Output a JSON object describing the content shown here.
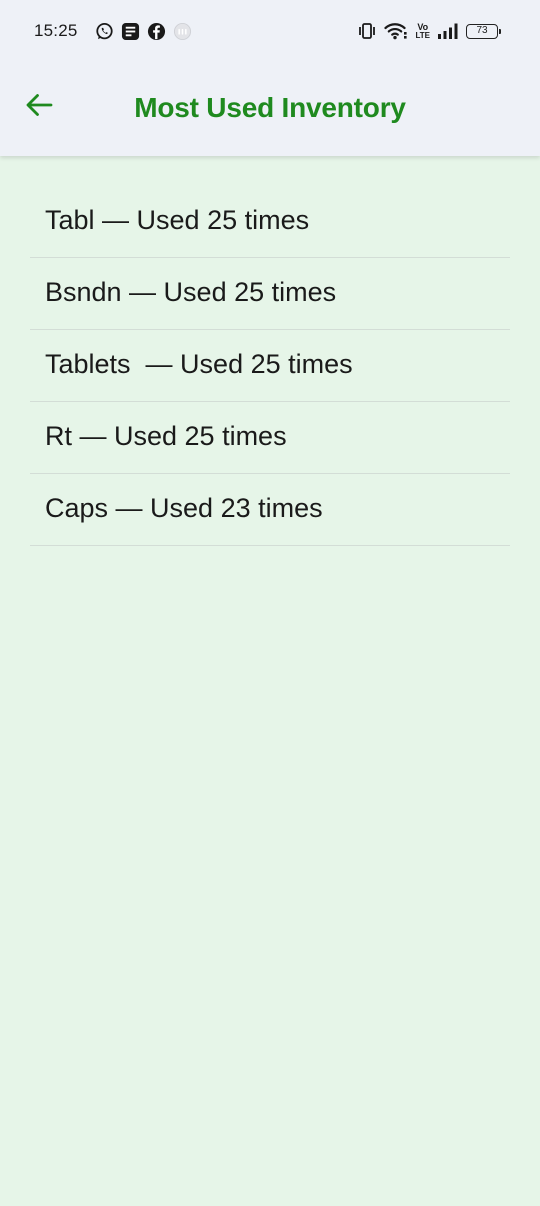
{
  "status_bar": {
    "time": "15:25",
    "notification_icons": [
      "whatsapp-icon",
      "notes-app-icon",
      "facebook-icon",
      "app-badge-icon"
    ],
    "system_icons": [
      "vibrate-icon",
      "wifi-icon",
      "volte-icon",
      "signal-icon"
    ],
    "volte_top": "Vo",
    "volte_bottom": "LTE",
    "battery_level": "73"
  },
  "header": {
    "back_icon": "arrow-left-icon",
    "title": "Most Used Inventory"
  },
  "items": [
    {
      "text": "Tabl — Used 25 times"
    },
    {
      "text": "Bsndn — Used 25 times"
    },
    {
      "text": "Tablets  — Used 25 times"
    },
    {
      "text": "Rt — Used 25 times"
    },
    {
      "text": "Caps — Used 23 times"
    }
  ],
  "colors": {
    "accent": "#1f8a1f",
    "header_background": "#eef1f7",
    "page_background": "#e6f5e8",
    "divider": "#d3ddd6"
  }
}
